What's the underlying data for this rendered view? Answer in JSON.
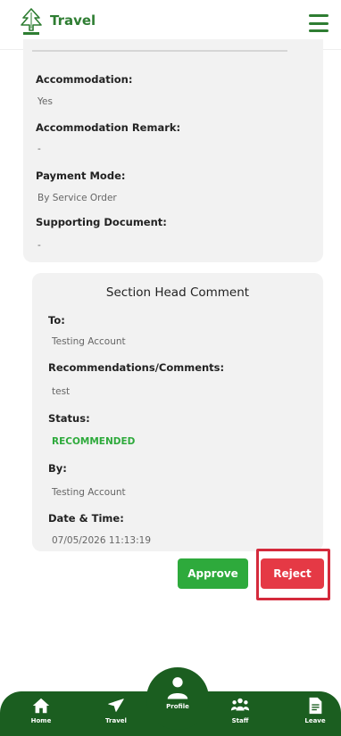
{
  "header": {
    "title": "Travel"
  },
  "details": {
    "accommodation_label": "Accommodation:",
    "accommodation_value": "Yes",
    "accommodation_remark_label": "Accommodation Remark:",
    "accommodation_remark_value": "-",
    "payment_mode_label": "Payment Mode:",
    "payment_mode_value": "By Service Order",
    "supporting_document_label": "Supporting Document:",
    "supporting_document_value": "-"
  },
  "section_head": {
    "title": "Section Head Comment",
    "to_label": "To:",
    "to_value": "Testing Account",
    "comments_label": "Recommendations/Comments:",
    "comments_value": "test",
    "status_label": "Status:",
    "status_value": "RECOMMENDED",
    "by_label": "By:",
    "by_value": "Testing Account",
    "datetime_label": "Date & Time:",
    "datetime_value": "07/05/2026 11:13:19"
  },
  "actions": {
    "approve_label": "Approve",
    "reject_label": "Reject"
  },
  "bottom_nav": {
    "home": "Home",
    "travel": "Travel",
    "profile": "Profile",
    "staff": "Staff",
    "leave": "Leave"
  },
  "colors": {
    "brand_green": "#2e7d32",
    "nav_green": "#1b5e20",
    "approve_green": "#2eaa3c",
    "reject_red": "#e53945",
    "highlight_red": "#d42a3c"
  }
}
